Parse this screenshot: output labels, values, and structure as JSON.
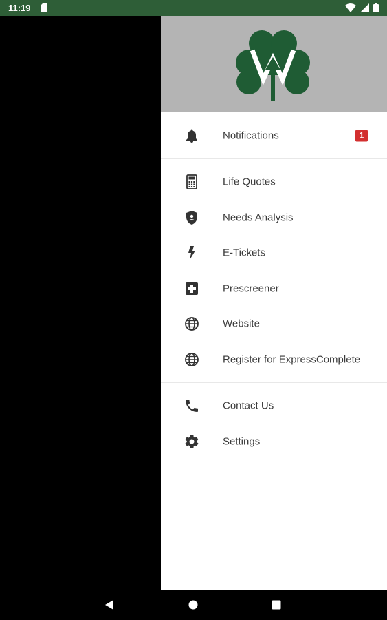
{
  "status_bar": {
    "time": "11:19",
    "icons": [
      "sd-card-icon",
      "wifi-icon",
      "signal-icon",
      "battery-icon"
    ]
  },
  "header": {
    "logo": "shamrock-arrow-logo",
    "background": "#b4b4b4",
    "logo_color": "#1f5c34"
  },
  "menu": {
    "notifications": {
      "label": "Notifications",
      "icon": "bell-icon",
      "badge": "1"
    },
    "items": [
      {
        "label": "Life Quotes",
        "icon": "calculator-icon"
      },
      {
        "label": "Needs Analysis",
        "icon": "shield-icon"
      },
      {
        "label": "E-Tickets",
        "icon": "lightning-icon"
      },
      {
        "label": "Prescreener",
        "icon": "medical-cross-icon"
      },
      {
        "label": "Website",
        "icon": "globe-icon"
      },
      {
        "label": "Register for ExpressComplete",
        "icon": "globe-icon"
      }
    ],
    "footer_items": [
      {
        "label": "Contact Us",
        "icon": "phone-icon"
      },
      {
        "label": "Settings",
        "icon": "gear-icon"
      }
    ]
  },
  "nav_bar": {
    "buttons": [
      "back-button",
      "home-button",
      "recents-button"
    ]
  },
  "colors": {
    "status_bar": "#2e5e37",
    "badge": "#d32f2f",
    "text": "#3a3a3a"
  }
}
